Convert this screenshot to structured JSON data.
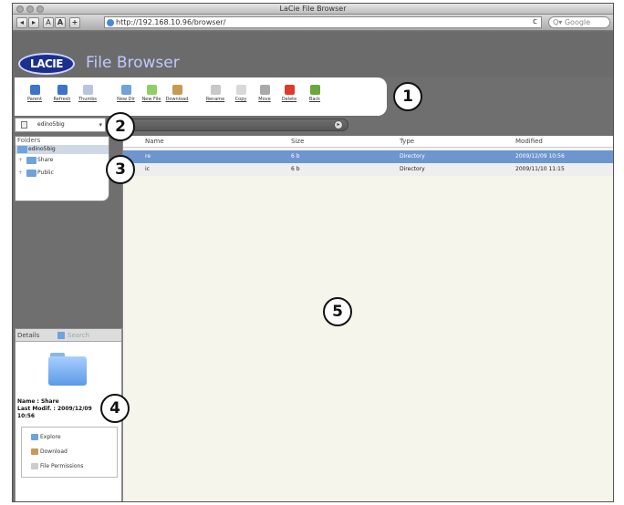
{
  "window": {
    "title": "LaCie File Browser"
  },
  "browser": {
    "back": "◂",
    "forward": "▸",
    "text_small": "A",
    "text_large": "A",
    "add": "+",
    "url": "http://192.168.10.96/browser/",
    "reload": "c",
    "search_placeholder": "Q▾ Google"
  },
  "app": {
    "logo": "LACIE",
    "title": "File Browser"
  },
  "toolbar": {
    "buttons": [
      {
        "label": "Parent",
        "icon": "parent-icon",
        "color": "#3b74c8"
      },
      {
        "label": "Refresh",
        "icon": "refresh-icon",
        "color": "#3b74c8"
      },
      {
        "label": "Thumbs",
        "icon": "thumbs-icon",
        "color": "#b7c6dc"
      },
      {
        "label": "New Dir",
        "icon": "new-dir-icon",
        "color": "#6ea3de"
      },
      {
        "label": "New File",
        "icon": "new-file-icon",
        "color": "#8fcf66"
      },
      {
        "label": "Download",
        "icon": "download-icon",
        "color": "#c89a52"
      },
      {
        "label": "Rename",
        "icon": "rename-icon",
        "color": "#c8c8c8"
      },
      {
        "label": "Copy",
        "icon": "copy-icon",
        "color": "#d9d9d9"
      },
      {
        "label": "Move",
        "icon": "move-icon",
        "color": "#aaaaaa"
      },
      {
        "label": "Delete",
        "icon": "delete-icon",
        "color": "#e03a2a"
      },
      {
        "label": "Back",
        "icon": "back-icon",
        "color": "#6aa83a"
      }
    ]
  },
  "drive": {
    "selected": "edino5big"
  },
  "folders": {
    "title": "Folders",
    "root": "edino5big",
    "items": [
      "Share",
      "Public"
    ]
  },
  "files": {
    "columns": [
      "Name",
      "Size",
      "Type",
      "Modified"
    ],
    "rows": [
      {
        "name": "re",
        "size": "6 b",
        "type": "Directory",
        "modified": "2009/12/09 10:56"
      },
      {
        "name": "ic",
        "size": "6 b",
        "type": "Directory",
        "modified": "2009/11/10 11:15"
      }
    ]
  },
  "details": {
    "tabs": [
      "Details",
      "Search"
    ],
    "name_line": "Name : Share",
    "modif_line": "Last Modif. : 2009/12/09",
    "modif_time": "10:56",
    "actions": [
      "Explore",
      "Download",
      "File Permissions"
    ]
  },
  "callouts": [
    "1",
    "2",
    "3",
    "4",
    "5"
  ]
}
